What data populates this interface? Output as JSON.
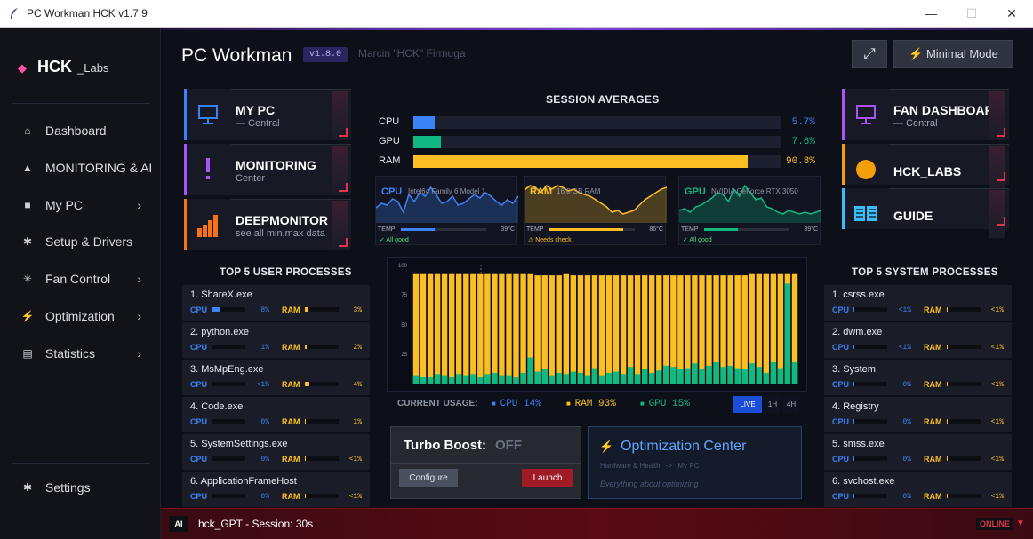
{
  "window": {
    "title": "PC Workman HCK  v1.7.9",
    "minimize": "—",
    "maximize": "☐",
    "close": "✕"
  },
  "sidebar": {
    "logo_main": "HCK",
    "logo_sub": "_Labs",
    "items": [
      {
        "label": "Dashboard",
        "icon": "home-icon",
        "glyph": "⌂"
      },
      {
        "label": "MONITORING & AI",
        "icon": "warning-icon",
        "glyph": "▲"
      },
      {
        "label": "My PC",
        "icon": "pc-icon",
        "glyph": "■",
        "chev": "›"
      },
      {
        "label": "Setup & Drivers",
        "icon": "gear-icon",
        "glyph": "✱"
      },
      {
        "label": "Fan Control",
        "icon": "fan-icon",
        "glyph": "✳",
        "chev": "›"
      },
      {
        "label": "Optimization",
        "icon": "bolt-icon",
        "glyph": "⚡",
        "chev": "›"
      },
      {
        "label": "Statistics",
        "icon": "stats-icon",
        "glyph": "▤",
        "chev": "›"
      }
    ],
    "settings": {
      "label": "Settings",
      "icon": "gear-icon",
      "glyph": "✱"
    }
  },
  "header": {
    "title": "PC Workman",
    "version": "v1.8.0",
    "author": "Marcin \"HCK\" Firmuga",
    "expand_glyph": "⤢",
    "minimal_mode": "⚡ Minimal Mode"
  },
  "left_cards": [
    {
      "title": "MY PC",
      "subtitle": "— Central",
      "icon": "monitor-icon",
      "color": "#3b82f6"
    },
    {
      "title": "MONITORING",
      "subtitle": "Center",
      "icon": "exclamation-icon",
      "color": "#a855f7"
    },
    {
      "title": "DEEPMONITOR",
      "subtitle": "see all min,max data",
      "icon": "bars-icon",
      "color": "#f97316"
    }
  ],
  "right_cards": [
    {
      "title": "FAN DASHBOARD",
      "subtitle": "— Central",
      "icon": "monitor-icon",
      "color": "#a855f7"
    },
    {
      "title": "HCK_LABS",
      "subtitle": "",
      "icon": "circle-icon",
      "color": "#f59e0b"
    },
    {
      "title": "GUIDE",
      "subtitle": "",
      "icon": "book-icon",
      "color": "#38bdf8"
    }
  ],
  "session": {
    "title": "SESSION AVERAGES",
    "rows": [
      {
        "label": "CPU",
        "value": "5.7%",
        "fraction": 0.057,
        "color": "#3b82f6"
      },
      {
        "label": "GPU",
        "value": "7.6%",
        "fraction": 0.076,
        "color": "#10b981"
      },
      {
        "label": "RAM",
        "value": "90.8%",
        "fraction": 0.908,
        "color": "#fbbf24"
      }
    ]
  },
  "minis": [
    {
      "title": "CPU",
      "model": "Intel64 Family 6 Model 1",
      "temp_label": "TEMP",
      "temp": "39°C",
      "temp_frac": 0.4,
      "status": "✓ All good",
      "color": "#3b82f6",
      "status_color": "#4ade80"
    },
    {
      "title": "RAM",
      "model": "16.0 GB RAM",
      "temp_label": "TEMP",
      "temp": "86°C",
      "temp_frac": 0.86,
      "status": "⚠ Needs check",
      "color": "#fbbf24",
      "status_color": "#fbbf24"
    },
    {
      "title": "GPU",
      "model": "NVIDIA GeForce RTX 3050",
      "temp_label": "TEMP",
      "temp": "39°C",
      "temp_frac": 0.4,
      "status": "✓ All good",
      "color": "#10b981",
      "status_color": "#4ade80"
    }
  ],
  "top_user": {
    "title": "TOP 5 USER PROCESSES",
    "items": [
      {
        "name": "1. ShareX.exe",
        "cpu_label": "CPU",
        "cpu": "8%",
        "cpu_frac": 0.08,
        "ram_label": "RAM",
        "ram": "3%",
        "ram_frac": 0.03
      },
      {
        "name": "2. python.exe",
        "cpu_label": "CPU",
        "cpu": "1%",
        "cpu_frac": 0.01,
        "ram_label": "RAM",
        "ram": "2%",
        "ram_frac": 0.02
      },
      {
        "name": "3. MsMpEng.exe",
        "cpu_label": "CPU",
        "cpu": "<1%",
        "cpu_frac": 0.005,
        "ram_label": "RAM",
        "ram": "4%",
        "ram_frac": 0.04
      },
      {
        "name": "4. Code.exe",
        "cpu_label": "CPU",
        "cpu": "0%",
        "cpu_frac": 0,
        "ram_label": "RAM",
        "ram": "1%",
        "ram_frac": 0.01
      },
      {
        "name": "5. SystemSettings.exe",
        "cpu_label": "CPU",
        "cpu": "0%",
        "cpu_frac": 0,
        "ram_label": "RAM",
        "ram": "<1%",
        "ram_frac": 0.005
      },
      {
        "name": "6. ApplicationFrameHost",
        "cpu_label": "CPU",
        "cpu": "0%",
        "cpu_frac": 0,
        "ram_label": "RAM",
        "ram": "<1%",
        "ram_frac": 0.005
      }
    ]
  },
  "top_system": {
    "title": "TOP 5 SYSTEM PROCESSES",
    "items": [
      {
        "name": "1. csrss.exe",
        "cpu_label": "CPU",
        "cpu": "<1%",
        "cpu_frac": 0.005,
        "ram_label": "RAM",
        "ram": "<1%",
        "ram_frac": 0.005
      },
      {
        "name": "2. dwm.exe",
        "cpu_label": "CPU",
        "cpu": "<1%",
        "cpu_frac": 0.005,
        "ram_label": "RAM",
        "ram": "<1%",
        "ram_frac": 0.005
      },
      {
        "name": "3. System",
        "cpu_label": "CPU",
        "cpu": "0%",
        "cpu_frac": 0,
        "ram_label": "RAM",
        "ram": "<1%",
        "ram_frac": 0.005
      },
      {
        "name": "4. Registry",
        "cpu_label": "CPU",
        "cpu": "0%",
        "cpu_frac": 0,
        "ram_label": "RAM",
        "ram": "<1%",
        "ram_frac": 0.005
      },
      {
        "name": "5. smss.exe",
        "cpu_label": "CPU",
        "cpu": "0%",
        "cpu_frac": 0,
        "ram_label": "RAM",
        "ram": "<1%",
        "ram_frac": 0.005
      },
      {
        "name": "6. svchost.exe",
        "cpu_label": "CPU",
        "cpu": "0%",
        "cpu_frac": 0,
        "ram_label": "RAM",
        "ram": "<1%",
        "ram_frac": 0.005
      }
    ]
  },
  "chart_data": {
    "type": "bar",
    "yticks": [
      "100",
      "75",
      "50",
      "25"
    ],
    "ylim": [
      0,
      100
    ],
    "ram": [
      92,
      92,
      92,
      92,
      92,
      92,
      92,
      92,
      92,
      92,
      92,
      92,
      92,
      92,
      92,
      92,
      92,
      91,
      91,
      91,
      91,
      92,
      91,
      91,
      91,
      91,
      91,
      91,
      91,
      91,
      91,
      91,
      91,
      91,
      91,
      91,
      91,
      91,
      91,
      91,
      91,
      91,
      91,
      91,
      91,
      91,
      91,
      92,
      92,
      92,
      92,
      92,
      92,
      92
    ],
    "gpu": [
      7,
      6,
      6,
      8,
      7,
      6,
      8,
      7,
      8,
      6,
      8,
      9,
      7,
      7,
      6,
      9,
      22,
      10,
      12,
      7,
      9,
      8,
      10,
      9,
      7,
      13,
      7,
      9,
      10,
      8,
      14,
      8,
      12,
      9,
      11,
      15,
      14,
      12,
      13,
      17,
      12,
      15,
      18,
      14,
      15,
      13,
      12,
      17,
      14,
      9,
      18,
      13,
      84,
      18
    ]
  },
  "current_usage": {
    "label": "CURRENT USAGE:",
    "cpu": "CPU 14%",
    "ram": "RAM 93%",
    "gpu": "GPU 15%",
    "ranges": [
      "LIVE",
      "1H",
      "4H"
    ]
  },
  "turbo": {
    "label": "Turbo Boost:",
    "state": "OFF",
    "configure": "Configure",
    "launch": "Launch"
  },
  "optimization": {
    "title": "Optimization Center",
    "crumb_a": "Hardware & Health",
    "crumb_sep": "->",
    "crumb_b": "My PC",
    "desc": "Everything about optimizing"
  },
  "bottom": {
    "ai": "AI",
    "text": "hck_GPT  -  Session: 30s",
    "status": "ONLINE",
    "arrow": "▼"
  }
}
